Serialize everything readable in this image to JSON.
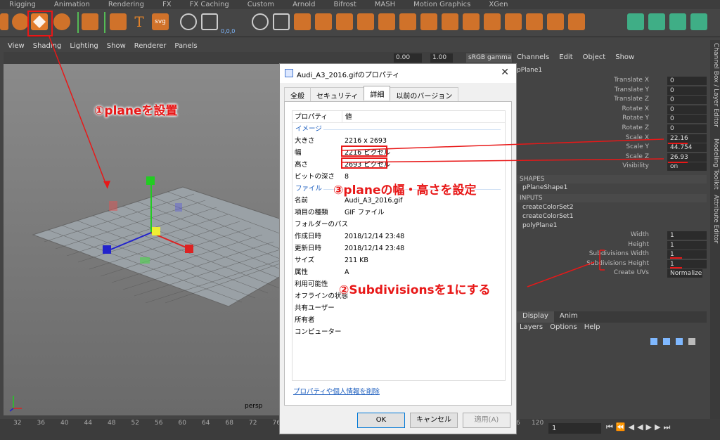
{
  "shelf_tabs": [
    "Rigging",
    "Animation",
    "Rendering",
    "FX",
    "FX Caching",
    "Custom",
    "Arnold",
    "Bifrost",
    "MASH",
    "Motion Graphics",
    "XGen"
  ],
  "shelf_text": {
    "text_tool": "T",
    "svg_tool": "svg",
    "coords": "0,0,0"
  },
  "viewport_menu": [
    "View",
    "Shading",
    "Lighting",
    "Show",
    "Renderer",
    "Panels"
  ],
  "viewport_toolbar": {
    "value1": "0.00",
    "value2": "1.00",
    "color_space": "sRGB gamma"
  },
  "viewport": {
    "camera_label": "persp"
  },
  "channel_box": {
    "menu": [
      "Channels",
      "Edit",
      "Object",
      "Show"
    ],
    "object_name": "pPlane1",
    "attributes": [
      {
        "label": "Translate X",
        "value": "0"
      },
      {
        "label": "Translate Y",
        "value": "0"
      },
      {
        "label": "Translate Z",
        "value": "0"
      },
      {
        "label": "Rotate X",
        "value": "0"
      },
      {
        "label": "Rotate Y",
        "value": "0"
      },
      {
        "label": "Rotate Z",
        "value": "0"
      },
      {
        "label": "Scale X",
        "value": "22.16"
      },
      {
        "label": "Scale Y",
        "value": "44.754"
      },
      {
        "label": "Scale Z",
        "value": "26.93"
      },
      {
        "label": "Visibility",
        "value": "on"
      }
    ],
    "shapes_header": "SHAPES",
    "shape_name": "pPlaneShape1",
    "inputs_header": "INPUTS",
    "inputs": [
      "createColorSet2",
      "createColorSet1",
      "polyPlane1"
    ],
    "poly_attrs": [
      {
        "label": "Width",
        "value": "1"
      },
      {
        "label": "Height",
        "value": "1"
      },
      {
        "label": "Subdivisions Width",
        "value": "1"
      },
      {
        "label": "Subdivisions Height",
        "value": "1"
      },
      {
        "label": "Create UVs",
        "value": "Normalize ..."
      }
    ]
  },
  "layer_editor": {
    "tabs": [
      "Display",
      "Anim"
    ],
    "menu": [
      "Layers",
      "Options",
      "Help"
    ]
  },
  "side_tabs": [
    "Channel Box / Layer Editor",
    "Modeling Toolkit",
    "Attribute Editor"
  ],
  "timeline": {
    "ticks": [
      "32",
      "36",
      "40",
      "44",
      "48",
      "52",
      "56",
      "60",
      "64",
      "68",
      "72",
      "76",
      "80",
      "84",
      "88",
      "92",
      "96",
      "100",
      "104",
      "108",
      "112",
      "116",
      "120"
    ],
    "current_frame": "1"
  },
  "dialog": {
    "title": "Audi_A3_2016.gifのプロパティ",
    "tabs": [
      "全般",
      "セキュリティ",
      "詳細",
      "以前のバージョン"
    ],
    "active_tab": 2,
    "header_key": "プロパティ",
    "header_val": "値",
    "group_image": "イメージ",
    "group_file": "ファイル",
    "image_props": [
      {
        "k": "大きさ",
        "v": "2216 x 2693"
      },
      {
        "k": "幅",
        "v": "2216 ピクセル"
      },
      {
        "k": "高さ",
        "v": "2693 ピクセル"
      },
      {
        "k": "ビットの深さ",
        "v": "8"
      }
    ],
    "file_props": [
      {
        "k": "名前",
        "v": "Audi_A3_2016.gif"
      },
      {
        "k": "項目の種類",
        "v": "GIF ファイル"
      },
      {
        "k": "フォルダーのパス",
        "v": ""
      },
      {
        "k": "作成日時",
        "v": "2018/12/14 23:48"
      },
      {
        "k": "更新日時",
        "v": "2018/12/14 23:48"
      },
      {
        "k": "サイズ",
        "v": "211 KB"
      },
      {
        "k": "属性",
        "v": "A"
      },
      {
        "k": "利用可能性",
        "v": ""
      },
      {
        "k": "オフラインの状態",
        "v": ""
      },
      {
        "k": "共有ユーザー",
        "v": ""
      },
      {
        "k": "所有者",
        "v": ""
      },
      {
        "k": "コンピューター",
        "v": ""
      }
    ],
    "remove_link": "プロパティや個人情報を削除",
    "ok": "OK",
    "cancel": "キャンセル",
    "apply": "適用(A)"
  },
  "annotations": {
    "a1": "①planeを設置",
    "a2": "②Subdivisionsを1にする",
    "a3": "③planeの幅・高さを設定"
  },
  "colors": {
    "annotation": "#e81818",
    "maya_bg": "#444444",
    "link_blue": "#1e5fbf"
  }
}
